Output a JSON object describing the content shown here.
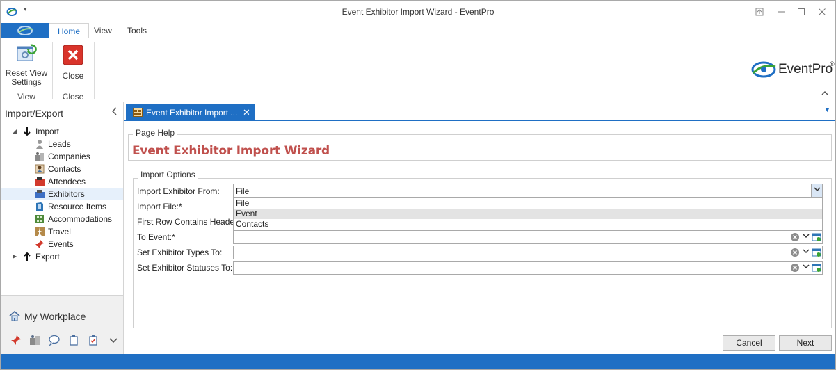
{
  "window": {
    "title": "Event Exhibitor Import Wizard - EventPro",
    "controls": [
      "pin",
      "minimize",
      "maximize",
      "close"
    ]
  },
  "ribbon": {
    "tabs": [
      {
        "label": "Home",
        "active": true
      },
      {
        "label": "View",
        "active": false
      },
      {
        "label": "Tools",
        "active": false
      }
    ],
    "reset_view_label_line1": "Reset View",
    "reset_view_label_line2": "Settings",
    "close_label": "Close",
    "group_view_label": "View",
    "group_close_label": "Close",
    "logo_text": "EventPro",
    "logo_registered": "®"
  },
  "nav": {
    "header": "Import/Export",
    "import_label": "Import",
    "items": [
      {
        "label": "Leads",
        "icon": "person-icon"
      },
      {
        "label": "Companies",
        "icon": "building-icon"
      },
      {
        "label": "Contacts",
        "icon": "contact-icon"
      },
      {
        "label": "Attendees",
        "icon": "attendee-icon"
      },
      {
        "label": "Exhibitors",
        "icon": "exhibitor-icon",
        "selected": true
      },
      {
        "label": "Resource Items",
        "icon": "resource-icon"
      },
      {
        "label": "Accommodations",
        "icon": "accommodation-icon"
      },
      {
        "label": "Travel",
        "icon": "plane-icon"
      },
      {
        "label": "Events",
        "icon": "pushpin-icon"
      }
    ],
    "export_label": "Export",
    "splitter_dots": "......",
    "workplace_label": "My Workplace"
  },
  "doc_tab": {
    "label": "Event Exhibitor Import ..."
  },
  "page_help": {
    "legend": "Page Help",
    "title": "Event Exhibitor Import Wizard"
  },
  "import_options": {
    "legend": "Import Options",
    "import_from_label": "Import Exhibitor From:",
    "import_from_value": "File",
    "import_file_label": "Import File:*",
    "first_row_label": "First Row Contains Headers",
    "to_event_label": "To Event:*",
    "types_label": "Set Exhibitor Types To:",
    "statuses_label": "Set Exhibitor Statuses To:",
    "dropdown_options": [
      "File",
      "Event",
      "Contacts"
    ],
    "dropdown_hovered": "Event"
  },
  "footer": {
    "cancel_label": "Cancel",
    "next_label": "Next"
  },
  "colors": {
    "accent": "#1f6fc4",
    "title_red": "#c0504d",
    "selected_bg": "#e6f0fb"
  }
}
